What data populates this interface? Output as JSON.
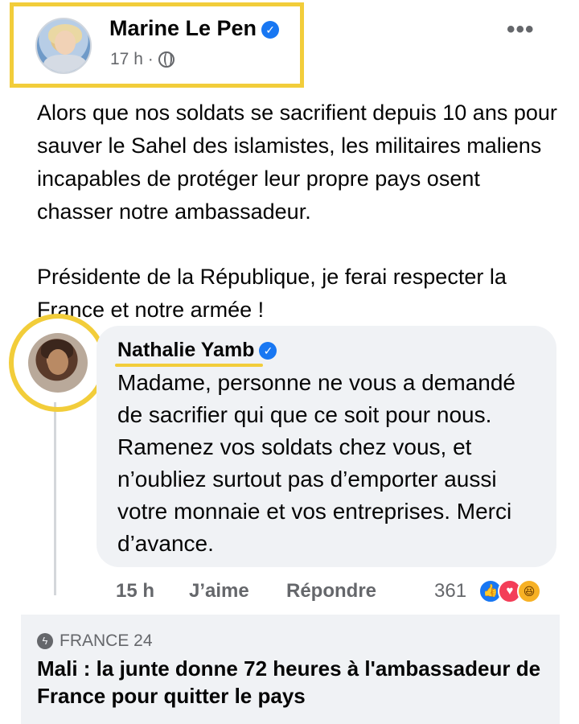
{
  "post": {
    "author": "Marine Le Pen",
    "time": "17 h ·",
    "more": "•••",
    "paragraphs": [
      "Alors que nos soldats se sacrifient depuis 10 ans pour sauver le Sahel des islamistes, les militaires maliens incapables de protéger leur propre pays osent chasser notre ambassadeur.",
      "Présidente de la République, je ferai respecter la France et notre armée !"
    ]
  },
  "comment": {
    "author": "Nathalie Yamb",
    "text": "Madame, personne ne vous a demandé de sacrifier qui que ce soit pour nous. Ramenez vos soldats chez vous, et n’oubliez surtout pas d’emporter aussi votre monnaie et vos entreprises. Merci d’avance.",
    "time": "15 h",
    "like_label": "J’aime",
    "reply_label": "Répondre",
    "reaction_count": "361"
  },
  "link_card": {
    "source": "FRANCE 24",
    "title": "Mali : la junte donne 72 heures à l'ambassadeur de France pour quitter le pays"
  },
  "icons": {
    "verified": "verified-badge-icon",
    "privacy": "globe-icon",
    "reactions": [
      "like-icon",
      "love-icon",
      "haha-icon"
    ],
    "source": "bolt-icon"
  },
  "colors": {
    "highlight": "#f2cd3a",
    "facebook_blue": "#1877f2",
    "secondary_text": "#65676b",
    "bubble_bg": "#f0f2f5"
  }
}
